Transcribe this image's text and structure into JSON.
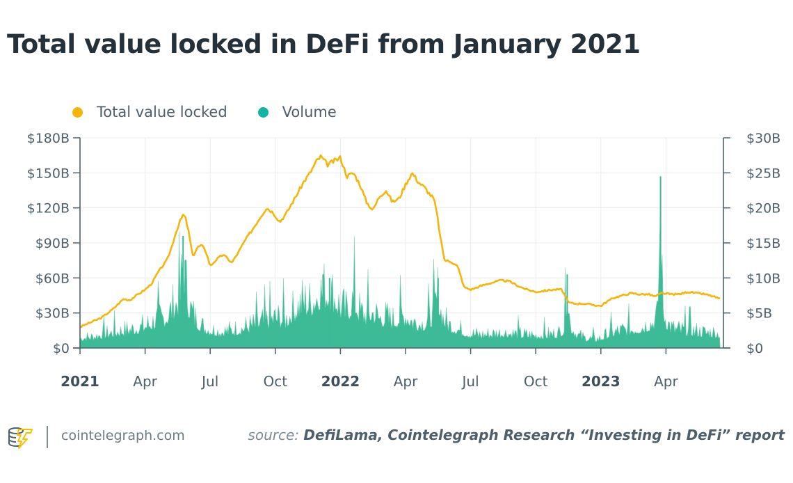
{
  "chart_data": {
    "type": "line",
    "title": "Total value locked in DeFi from January 2021",
    "legend_position": "top-left",
    "legend": [
      {
        "name": "Total value locked",
        "color": "#f5b50a",
        "kind": "line",
        "axis": "left"
      },
      {
        "name": "Volume",
        "color": "#3dbb97",
        "kind": "area",
        "axis": "right"
      }
    ],
    "x_axis": {
      "type": "time",
      "range": [
        "2021-01",
        "2023-06"
      ],
      "ticks": [
        {
          "label": "2021",
          "month": 0,
          "bold": true
        },
        {
          "label": "Apr",
          "month": 3,
          "bold": false
        },
        {
          "label": "Jul",
          "month": 6,
          "bold": false
        },
        {
          "label": "Oct",
          "month": 9,
          "bold": false
        },
        {
          "label": "2022",
          "month": 12,
          "bold": true
        },
        {
          "label": "Apr",
          "month": 15,
          "bold": false
        },
        {
          "label": "Jul",
          "month": 18,
          "bold": false
        },
        {
          "label": "Oct",
          "month": 21,
          "bold": false
        },
        {
          "label": "2023",
          "month": 24,
          "bold": true
        },
        {
          "label": "Apr",
          "month": 27,
          "bold": false
        }
      ],
      "grid": true
    },
    "y_left": {
      "label": "Total value locked",
      "unit": "$B",
      "range": [
        0,
        180
      ],
      "ticks": [
        {
          "value": 0,
          "label": "$0"
        },
        {
          "value": 30,
          "label": "$30B"
        },
        {
          "value": 60,
          "label": "$60B"
        },
        {
          "value": 90,
          "label": "$90B"
        },
        {
          "value": 120,
          "label": "$120B"
        },
        {
          "value": 150,
          "label": "$150B"
        },
        {
          "value": 180,
          "label": "$180B"
        }
      ],
      "grid": true
    },
    "y_right": {
      "label": "Volume",
      "unit": "$B",
      "range": [
        0,
        30
      ],
      "ticks": [
        {
          "value": 0,
          "label": "$0"
        },
        {
          "value": 5,
          "label": "$5B"
        },
        {
          "value": 10,
          "label": "$10B"
        },
        {
          "value": 15,
          "label": "$15B"
        },
        {
          "value": 20,
          "label": "$20B"
        },
        {
          "value": 25,
          "label": "$25B"
        },
        {
          "value": 30,
          "label": "$30B"
        }
      ]
    },
    "series": [
      {
        "name": "Total value locked",
        "axis": "left",
        "x_months": [
          0,
          0.5,
          1,
          1.5,
          2,
          2.3,
          2.6,
          3,
          3.3,
          3.6,
          4,
          4.2,
          4.4,
          4.6,
          4.75,
          4.85,
          5,
          5.2,
          5.4,
          5.6,
          5.8,
          6,
          6.3,
          6.6,
          7,
          7.3,
          7.6,
          8,
          8.3,
          8.6,
          8.9,
          9.2,
          9.5,
          9.8,
          10.1,
          10.3,
          10.6,
          10.9,
          11.1,
          11.4,
          11.7,
          12,
          12.3,
          12.6,
          12.9,
          13.2,
          13.5,
          13.8,
          14.1,
          14.4,
          14.7,
          15,
          15.3,
          15.6,
          15.9,
          16.1,
          16.3,
          16.45,
          16.6,
          16.8,
          17.1,
          17.4,
          17.7,
          18,
          18.3,
          18.6,
          19,
          19.4,
          19.8,
          20.2,
          20.6,
          21,
          21.4,
          21.8,
          22.2,
          22.5,
          22.8,
          23.2,
          23.6,
          24,
          24.3,
          24.6,
          25,
          25.4,
          25.8,
          26.2,
          26.5,
          26.8,
          27.2,
          27.6,
          28,
          28.4,
          28.8,
          29.2,
          29.5
        ],
        "values": [
          18,
          22,
          26,
          33,
          42,
          41,
          45,
          50,
          55,
          65,
          75,
          85,
          98,
          108,
          114,
          112,
          100,
          78,
          86,
          88,
          83,
          70,
          76,
          80,
          73,
          82,
          92,
          103,
          112,
          120,
          116,
          108,
          115,
          125,
          135,
          142,
          150,
          160,
          164,
          157,
          160,
          163,
          147,
          150,
          140,
          125,
          118,
          130,
          135,
          125,
          128,
          140,
          150,
          142,
          137,
          132,
          128,
          115,
          95,
          75,
          74,
          70,
          52,
          50,
          52,
          54,
          56,
          58,
          57,
          53,
          50,
          48,
          49,
          50,
          50,
          39,
          38,
          38,
          37,
          36,
          40,
          43,
          45,
          47,
          46,
          46,
          44,
          47,
          46,
          46,
          48,
          47,
          46,
          44,
          42
        ]
      },
      {
        "name": "Volume",
        "axis": "right",
        "x_months": [
          0,
          0.5,
          1,
          1.5,
          2,
          2.5,
          3,
          3.5,
          4,
          4.3,
          4.6,
          4.75,
          4.85,
          5,
          5.3,
          5.6,
          6,
          6.5,
          7,
          7.5,
          8,
          8.5,
          9,
          9.5,
          10,
          10.3,
          10.6,
          10.9,
          11.2,
          11.5,
          11.8,
          12,
          12.3,
          12.6,
          12.9,
          13.2,
          13.5,
          13.8,
          14.1,
          14.4,
          14.7,
          15,
          15.3,
          15.6,
          15.9,
          16.2,
          16.4,
          16.5,
          16.6,
          16.8,
          17.1,
          17.4,
          17.7,
          18,
          18.5,
          19,
          19.5,
          20,
          20.5,
          21,
          21.5,
          22,
          22.3,
          22.45,
          22.6,
          22.9,
          23.3,
          23.7,
          24,
          24.5,
          25,
          25.5,
          26,
          26.3,
          26.6,
          26.75,
          26.85,
          27,
          27.3,
          27.6,
          28,
          28.4,
          28.8,
          29.2,
          29.5
        ],
        "values": [
          1.8,
          2.0,
          2.4,
          2.8,
          3.2,
          3.5,
          4.0,
          5.0,
          5.8,
          7.5,
          9.0,
          16.0,
          12.5,
          8.0,
          5.5,
          4.0,
          3.3,
          3.0,
          3.2,
          3.6,
          4.2,
          4.8,
          5.5,
          5.2,
          7.5,
          8.5,
          8.0,
          9.5,
          10.5,
          10.0,
          9.0,
          7.5,
          6.5,
          9.0,
          6.5,
          6.0,
          6.5,
          5.5,
          5.5,
          5.0,
          5.5,
          6.0,
          5.0,
          4.5,
          4.5,
          5.5,
          8.0,
          10.0,
          7.0,
          5.0,
          4.0,
          3.5,
          3.0,
          2.6,
          2.4,
          2.6,
          2.8,
          2.6,
          2.4,
          2.3,
          2.4,
          2.6,
          3.4,
          10.5,
          4.0,
          2.4,
          1.8,
          1.6,
          1.8,
          2.8,
          3.2,
          3.5,
          4.0,
          4.5,
          5.5,
          24.5,
          7.5,
          5.0,
          3.5,
          3.3,
          3.2,
          3.0,
          2.8,
          2.8,
          2.5
        ]
      }
    ]
  },
  "footer": {
    "site": "cointelegraph.com",
    "source_prefix": "source:",
    "source_body": "DefiLama, Cointelegraph Research “Investing in DeFi” report"
  }
}
